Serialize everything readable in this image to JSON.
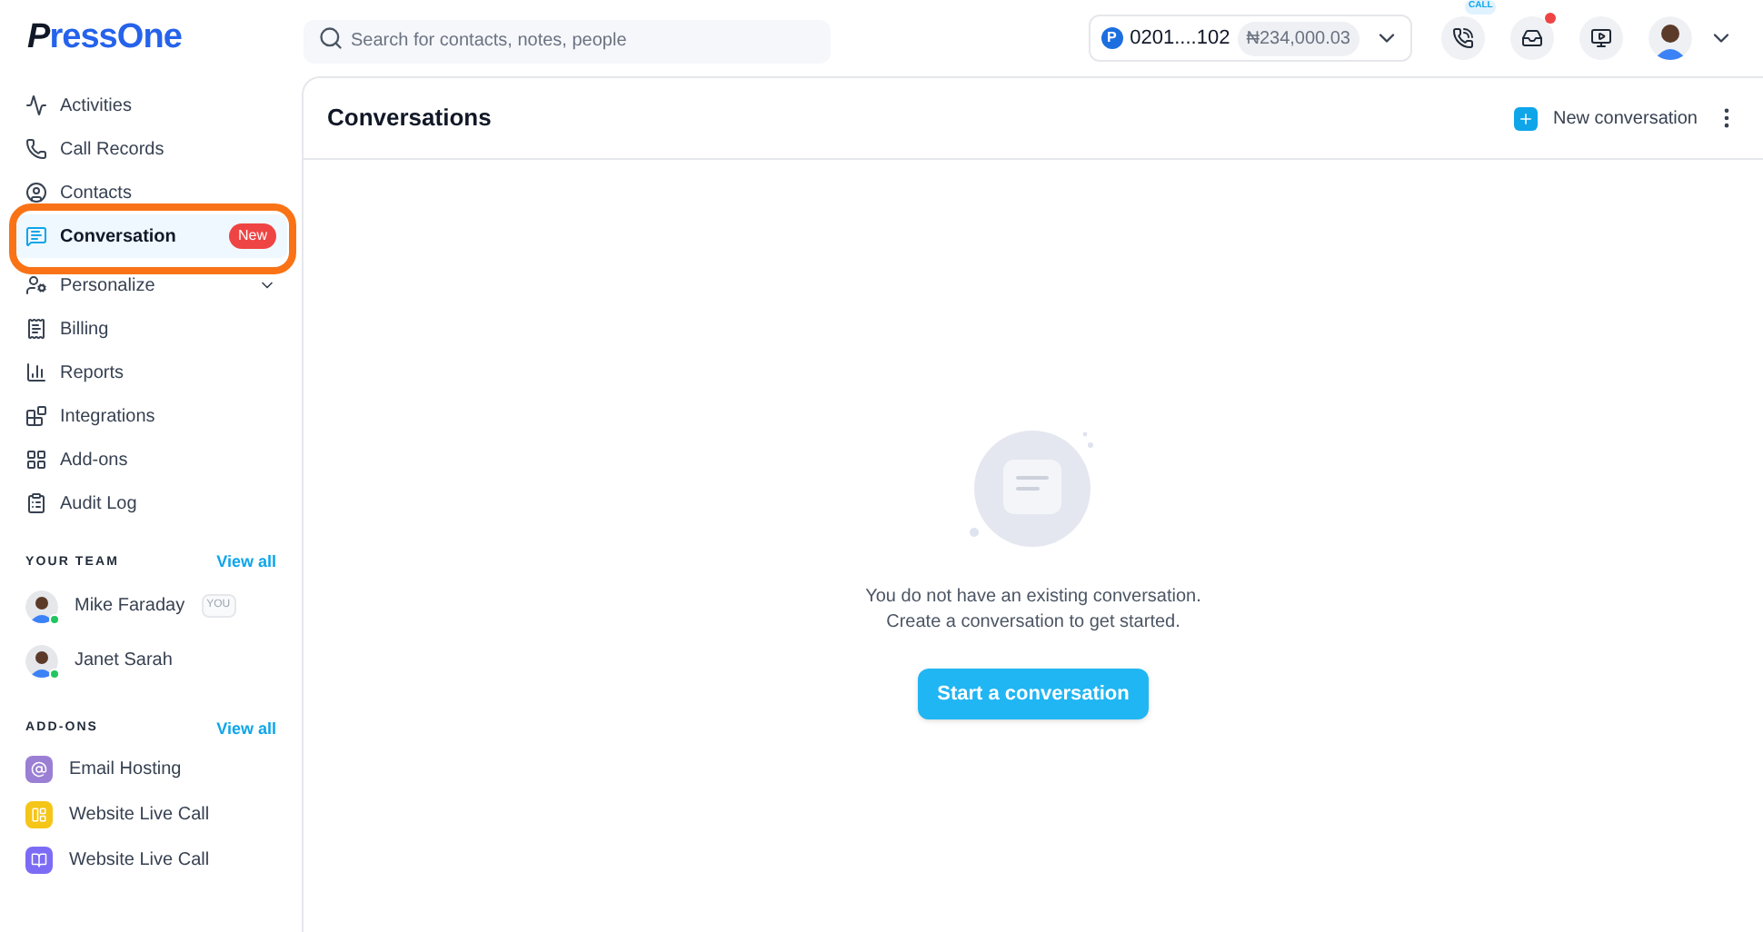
{
  "logo": {
    "mark": "P",
    "text": "ressOne"
  },
  "search": {
    "placeholder": "Search for contacts, notes, people"
  },
  "account": {
    "badge": "P",
    "number": "0201....102",
    "balance": "₦234,000.03"
  },
  "header_icons": {
    "call_label": "CALL",
    "inbox_unread": true
  },
  "nav": [
    {
      "label": "Activities",
      "selected": false,
      "annotated": false
    },
    {
      "label": "Call Records",
      "selected": false,
      "annotated": false
    },
    {
      "label": "Contacts",
      "selected": false,
      "annotated": false
    },
    {
      "label": "Conversation",
      "selected": true,
      "annotated": true,
      "badge": "New"
    },
    {
      "label": "Personalize",
      "selected": false,
      "annotated": false,
      "expanded": false
    },
    {
      "label": "Billing",
      "selected": false,
      "annotated": false
    },
    {
      "label": "Reports",
      "selected": false,
      "annotated": false
    },
    {
      "label": "Integrations",
      "selected": false,
      "annotated": false
    },
    {
      "label": "Add-ons",
      "selected": false,
      "annotated": false
    },
    {
      "label": "Audit Log",
      "selected": false,
      "annotated": false
    }
  ],
  "team": {
    "title": "YOUR TEAM",
    "link": "View all",
    "members": [
      {
        "name": "Mike Faraday",
        "tag": "YOU",
        "online": true
      },
      {
        "name": "Janet Sarah",
        "online": true
      }
    ]
  },
  "addons": {
    "title": "ADD-ONS",
    "link": "View all",
    "items": [
      {
        "label": "Email Hosting",
        "color": "#9b7fd4"
      },
      {
        "label": "Website Live Call",
        "color": "#f5c518"
      },
      {
        "label": "Website Live Call",
        "color": "#7c6cf5"
      }
    ]
  },
  "main": {
    "title": "Conversations",
    "new_button": "New conversation",
    "empty_lines": [
      "You do not have an existing conversation.",
      "Create a conversation to get started."
    ],
    "start_button": "Start a conversation"
  }
}
